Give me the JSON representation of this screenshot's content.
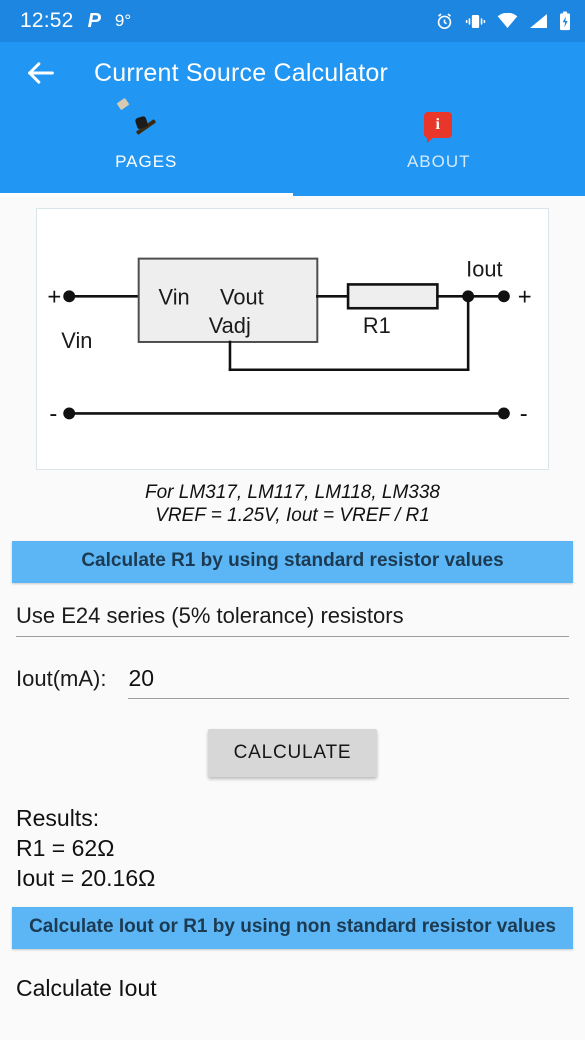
{
  "status_bar": {
    "time": "12:52",
    "provider_glyph": "P",
    "temperature": "9°",
    "icons": [
      "alarm-clock-icon",
      "vibrate-icon",
      "wifi-icon",
      "signal-icon",
      "battery-charging-icon"
    ]
  },
  "app_bar": {
    "back_icon": "back-arrow-icon",
    "title": "Current Source Calculator",
    "background_color": "#2196f3"
  },
  "tabs": [
    {
      "label": "PAGES",
      "icon": "tools-icon",
      "active": true
    },
    {
      "label": "ABOUT",
      "icon": "info-bubble-icon",
      "active": false
    }
  ],
  "diagram": {
    "labels": {
      "plus_left": "+",
      "minus_left": "-",
      "plus_right": "+",
      "minus_right": "-",
      "vin_terminal": "Vin",
      "vin_pin": "Vin",
      "vout_pin": "Vout",
      "vadj_pin": "Vadj",
      "resistor": "R1",
      "iout": "Iout"
    }
  },
  "note": {
    "line1": "For LM317, LM117, LM118, LM338",
    "line2": "VREF = 1.25V,  Iout = VREF / R1"
  },
  "section_standard": {
    "header": "Calculate R1 by using standard resistor values",
    "bar_color": "#5cb6f5",
    "series_selector": {
      "value": "Use E24 series (5% tolerance) resistors"
    },
    "iout_field": {
      "label": "Iout(mA):",
      "value": "20",
      "placeholder": ""
    },
    "calculate_button": "CALCULATE",
    "results": {
      "title": "Results:",
      "r1": "R1 = 62Ω",
      "iout": "Iout = 20.16Ω"
    }
  },
  "section_nonstandard": {
    "header": "Calculate Iout or R1 by using non standard resistor values",
    "subtitle": "Calculate Iout"
  }
}
